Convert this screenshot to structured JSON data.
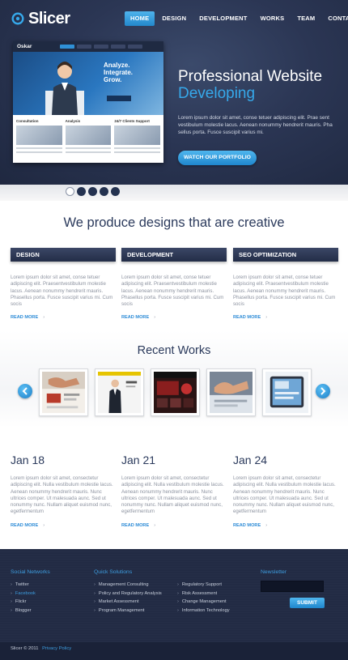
{
  "brand": {
    "name": "Slicer"
  },
  "nav": {
    "items": [
      {
        "label": "HOME",
        "active": true
      },
      {
        "label": "DESIGN",
        "active": false
      },
      {
        "label": "DEVELOPMENT",
        "active": false
      },
      {
        "label": "WORKS",
        "active": false
      },
      {
        "label": "TEAM",
        "active": false
      },
      {
        "label": "CONTACTS",
        "active": false
      }
    ]
  },
  "hero": {
    "mock": {
      "brand": "Oskar",
      "headline": [
        "Analyze.",
        "Integrate.",
        "Grow."
      ],
      "columns": [
        "Consultation",
        "Analysis",
        "24/7 Clients Support"
      ]
    },
    "title": "Professional Website",
    "subtitle": "Developing",
    "text": "Lorem ipsum dolor sit amet, conse tetuer adipiscing elit. Prae sent vestibulum molestie lacus. Aenean nonummy hendrerit mauris. Pha sellus porta. Fusce suscipit varius mi.",
    "button": "WATCH OUR PORTFOLIO",
    "slides": 5,
    "active_slide": 1
  },
  "services": {
    "tagline": "We produce designs that are creative",
    "items": [
      {
        "title": "DESIGN",
        "text": "Lorem ipsum dolor sit amet, conse tetuer adipiscing elit. Praesentvestibulum molestie lacus. Aenean nonummy hendrerit mauris. Phasellus porta. Fusce suscipit varius mi. Cum socis",
        "link": "READ MORE"
      },
      {
        "title": "DEVELOPMENT",
        "text": "Lorem ipsum dolor sit amet, conse tetuer adipiscing elit. Praesentvestibulum molestie lacus. Aenean nonummy hendrerit mauris. Phasellus porta. Fusce suscipit varius mi. Cum socis",
        "link": "READ MORE"
      },
      {
        "title": "SEO OPTIMIZATION",
        "text": "Lorem ipsum dolor sit amet, conse tetuer adipiscing elit. Praesentvestibulum molestie lacus. Aenean nonummy hendrerit mauris. Phasellus porta. Fusce suscipit varius mi. Cum socis",
        "link": "READ MORE"
      }
    ]
  },
  "works": {
    "title": "Recent Works",
    "thumbs": [
      "handshake-photo",
      "businessman-photo",
      "website-preview-red",
      "handshake-office-photo",
      "tablet-website-preview",
      "flag-handshake-photo"
    ]
  },
  "news": {
    "items": [
      {
        "date": "Jan 18",
        "text": "Lorem ipsum dolor sit amet, consectetur adipiscing elit. Nulla vestibulum molestie lacus. Aenean nonummy hendrerit mauris. Nunc ultrices comper. Ut malesuada aunc. Sed ut nonummy nunc. Nullam aliquet euismod nunc, egetfermentum",
        "link": "READ MORE"
      },
      {
        "date": "Jan 21",
        "text": "Lorem ipsum dolor sit amet, consectetur adipiscing elit. Nulla vestibulum molestie lacus. Aenean nonummy hendrerit mauris. Nunc ultrices comper. Ut malesuada aunc. Sed ut nonummy nunc. Nullam aliquet euismod nunc, egetfermentum",
        "link": "READ MORE"
      },
      {
        "date": "Jan 24",
        "text": "Lorem ipsum dolor sit amet, consectetur adipiscing elit. Nulla vestibulum molestie lacus. Aenean nonummy hendrerit mauris. Nunc ultrices comper. Ut malesuada aunc. Sed ut nonummy nunc. Nullam aliquet euismod nunc, egetfermentum",
        "link": "READ MORE"
      }
    ]
  },
  "footer": {
    "social": {
      "title": "Social Networks",
      "items": [
        "Twitter",
        "Facebook",
        "Flickr",
        "Blogger"
      ],
      "active": "Facebook"
    },
    "solutions": {
      "title": "Quick Solutions",
      "col1": [
        "Management Consulting",
        "Policy and Regulatory Analysis",
        "Market Assessment",
        "Program Management"
      ],
      "col2": [
        "Regulatory Support",
        "Risk Assessment",
        "Change Management",
        "Information Technology"
      ]
    },
    "newsletter": {
      "title": "Newsletter",
      "placeholder": "",
      "button": "SUBMIT"
    },
    "copyright": "Slicer © 2011",
    "privacy": "Privacy Policy"
  },
  "colors": {
    "accent": "#2a8ad6",
    "hero_bg": "#2b3654",
    "heading": "#2b3a5c",
    "footer_bg": "#222b44"
  }
}
